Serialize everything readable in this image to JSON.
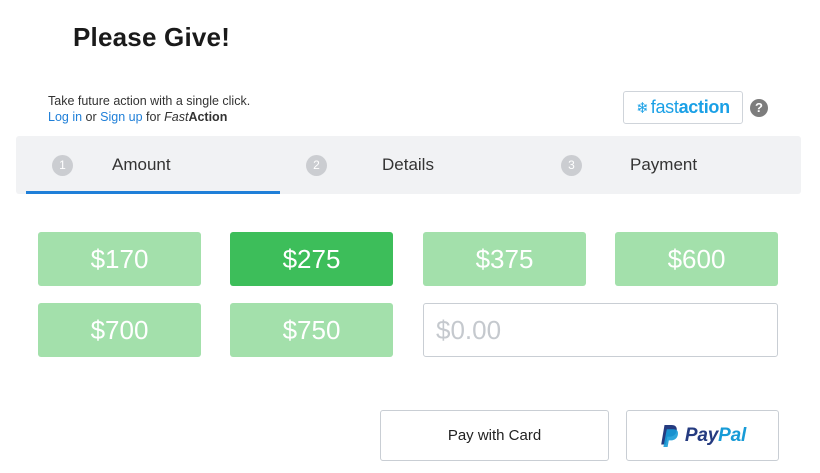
{
  "page": {
    "title": "Please Give!"
  },
  "fastaction": {
    "intro": "Take future action with a single click.",
    "login_link": "Log in",
    "or_text": "or",
    "signup_link": "Sign up",
    "for_text": "for",
    "brand_italic": "Fast",
    "brand_bold": "Action",
    "logo_fast": "fast",
    "logo_action": "action",
    "help_label": "?"
  },
  "steps": [
    {
      "number": "1",
      "label": "Amount",
      "active": true
    },
    {
      "number": "2",
      "label": "Details",
      "active": false
    },
    {
      "number": "3",
      "label": "Payment",
      "active": false
    }
  ],
  "amounts": [
    {
      "label": "$170",
      "selected": false
    },
    {
      "label": "$275",
      "selected": true
    },
    {
      "label": "$375",
      "selected": false
    },
    {
      "label": "$600",
      "selected": false
    },
    {
      "label": "$700",
      "selected": false
    },
    {
      "label": "$750",
      "selected": false
    }
  ],
  "custom_amount": {
    "value": "",
    "placeholder": "$0.00"
  },
  "payment": {
    "card_label": "Pay with Card",
    "paypal_pay": "Pay",
    "paypal_pal": "Pal"
  },
  "colors": {
    "accent": "#1f7fd8",
    "amount_selected": "#3dbe5a",
    "amount_default": "#a3e0ab",
    "paypal_dark": "#253b80",
    "paypal_light": "#179bd7",
    "fastaction_blue": "#1aa0e6"
  },
  "icons": {
    "help": "question-circle-icon",
    "fastaction": "fastaction-snowflake-icon",
    "paypal": "paypal-p-icon"
  }
}
